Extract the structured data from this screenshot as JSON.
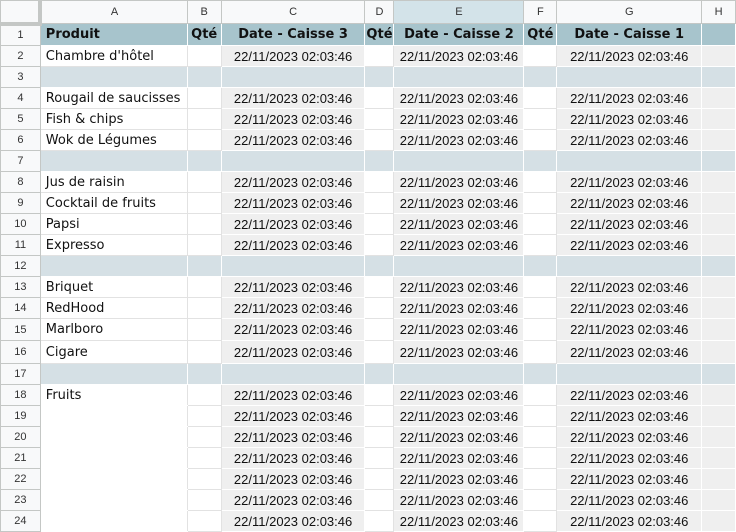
{
  "columns": [
    "A",
    "B",
    "C",
    "D",
    "E",
    "F",
    "G",
    "H"
  ],
  "selected_column": "E",
  "header": {
    "produit": "Produit",
    "qte": "Qté",
    "date_c3": "Date - Caisse 3",
    "date_c2": "Date - Caisse 2",
    "date_c1": "Date - Caisse 1"
  },
  "rows": [
    {
      "n": "1",
      "type": "header"
    },
    {
      "n": "2",
      "type": "item",
      "product": "Chambre d'hôtel",
      "date": "22/11/2023 02:03:46"
    },
    {
      "n": "3",
      "type": "sep"
    },
    {
      "n": "4",
      "type": "item",
      "product": "Rougail de saucisses",
      "date": "22/11/2023 02:03:46"
    },
    {
      "n": "5",
      "type": "item",
      "product": "Fish & chips",
      "date": "22/11/2023 02:03:46"
    },
    {
      "n": "6",
      "type": "item",
      "product": "Wok de Légumes",
      "date": "22/11/2023 02:03:46"
    },
    {
      "n": "7",
      "type": "sep"
    },
    {
      "n": "8",
      "type": "item",
      "product": "Jus de raisin",
      "date": "22/11/2023 02:03:46"
    },
    {
      "n": "9",
      "type": "item",
      "product": "Cocktail de fruits",
      "date": "22/11/2023 02:03:46"
    },
    {
      "n": "10",
      "type": "item",
      "product": "Papsi",
      "date": "22/11/2023 02:03:46"
    },
    {
      "n": "11",
      "type": "item",
      "product": "Expresso",
      "date": "22/11/2023 02:03:46"
    },
    {
      "n": "12",
      "type": "sep"
    },
    {
      "n": "13",
      "type": "item",
      "product": "Briquet",
      "date": "22/11/2023 02:03:46"
    },
    {
      "n": "14",
      "type": "item",
      "product": "RedHood",
      "date": "22/11/2023 02:03:46"
    },
    {
      "n": "15",
      "type": "item",
      "product": "Marlboro",
      "date": "22/11/2023 02:03:46"
    },
    {
      "n": "16",
      "type": "item",
      "product": "Cigare",
      "date": "22/11/2023 02:03:46"
    },
    {
      "n": "17",
      "type": "sep"
    },
    {
      "n": "18",
      "type": "item",
      "product": "Fruits",
      "date": "22/11/2023 02:03:46"
    },
    {
      "n": "19",
      "type": "item",
      "product": "",
      "date": "22/11/2023 02:03:46"
    },
    {
      "n": "20",
      "type": "item",
      "product": "",
      "date": "22/11/2023 02:03:46"
    },
    {
      "n": "21",
      "type": "item",
      "product": "",
      "date": "22/11/2023 02:03:46"
    },
    {
      "n": "22",
      "type": "item",
      "product": "",
      "date": "22/11/2023 02:03:46"
    },
    {
      "n": "23",
      "type": "item",
      "product": "",
      "date": "22/11/2023 02:03:46"
    },
    {
      "n": "24",
      "type": "item",
      "product": "",
      "date": "22/11/2023 02:03:46"
    }
  ]
}
